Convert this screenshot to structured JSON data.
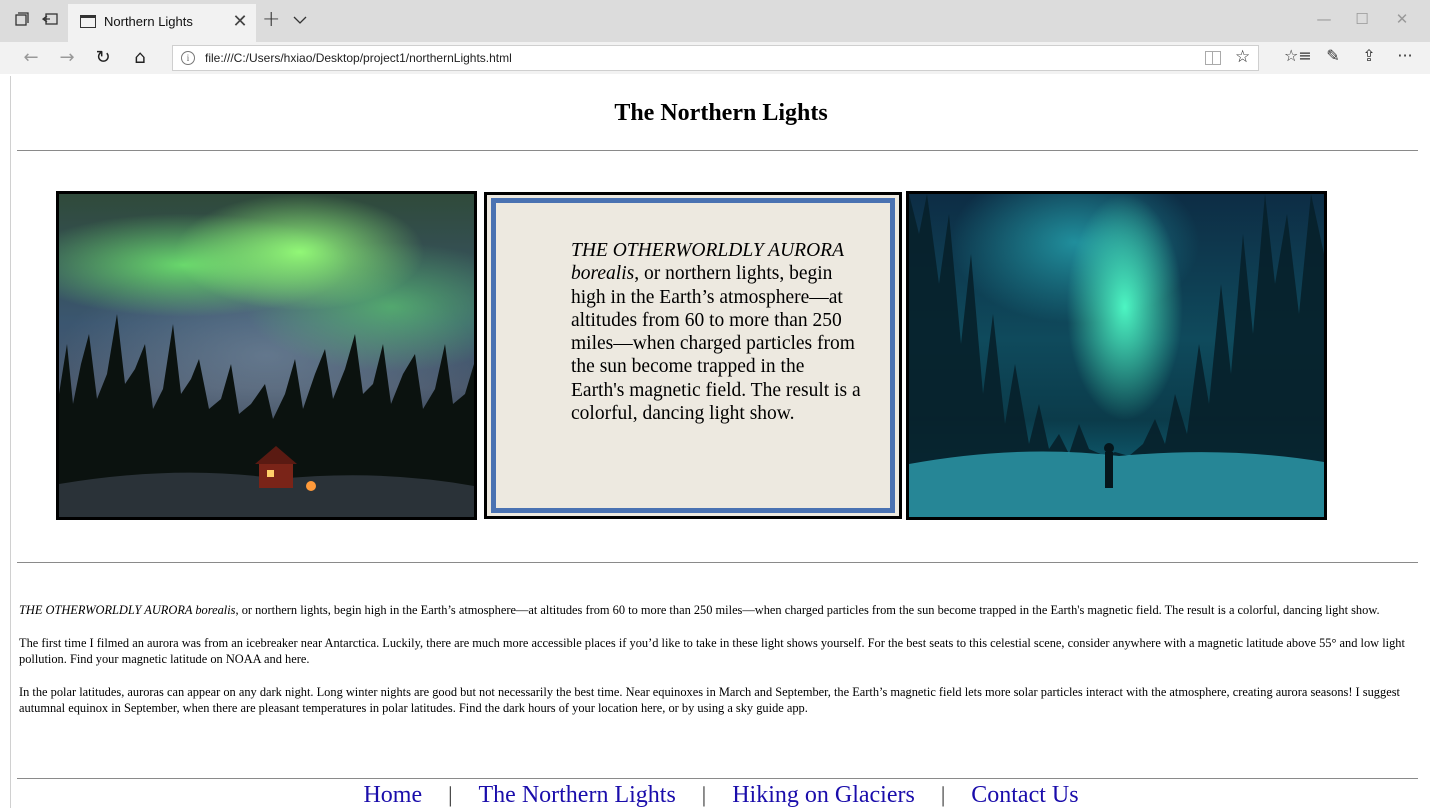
{
  "browser": {
    "tab_title": "Northern Lights",
    "url": "file:///C:/Users/hxiao/Desktop/project1/northernLights.html"
  },
  "page": {
    "title": "The Northern Lights",
    "panel": {
      "lead_italic": "THE OTHERWORLDLY AURORA borealis",
      "rest": ", or northern lights, begin high in the Earth’s atmosphere—at altitudes from 60 to more than 250 miles—when charged particles from the sun become trapped in the Earth's magnetic field. The result is a colorful, dancing light show."
    },
    "paragraphs": [
      {
        "lead_italic": "THE OTHERWORLDLY AURORA borealis",
        "rest": ", or northern lights, begin high in the Earth’s atmosphere—at altitudes from 60 to more than 250 miles—when charged particles from the sun become trapped in the Earth's magnetic field. The result is a colorful, dancing light show."
      },
      {
        "text": "The first time I filmed an aurora was from an icebreaker near Antarctica. Luckily, there are much more accessible places if you’d like to take in these light shows yourself. For the best seats to this celestial scene, consider anywhere with a magnetic latitude above 55° and low light pollution. Find your magnetic latitude on NOAA and here."
      },
      {
        "text": "In the polar latitudes, auroras can appear on any dark night. Long winter nights are good but not necessarily the best time. Near equinoxes in March and September, the Earth’s magnetic field lets more solar particles interact with the atmosphere, creating aurora seasons! I suggest autumnal equinox in September, when there are pleasant temperatures in polar latitudes. Find the dark hours of your location here, or by using a sky guide app."
      }
    ],
    "nav": [
      {
        "label": "Home"
      },
      {
        "label": "The Northern Lights"
      },
      {
        "label": "Hiking on Glaciers"
      },
      {
        "label": "Contact Us"
      }
    ],
    "nav_separator": "|"
  },
  "icons": {
    "tab_actions": "tab-actions-icon",
    "set_aside": "set-aside-tabs-icon",
    "back": "←",
    "forward": "→",
    "refresh": "↻",
    "home": "⌂",
    "favorite": "☆",
    "favorites_hub": "☆≡",
    "notes": "✎",
    "share": "⇪",
    "more": "···",
    "minimize": "—",
    "maximize": "☐",
    "close": "✕",
    "new_tab": "+",
    "tab_close": "✕"
  }
}
